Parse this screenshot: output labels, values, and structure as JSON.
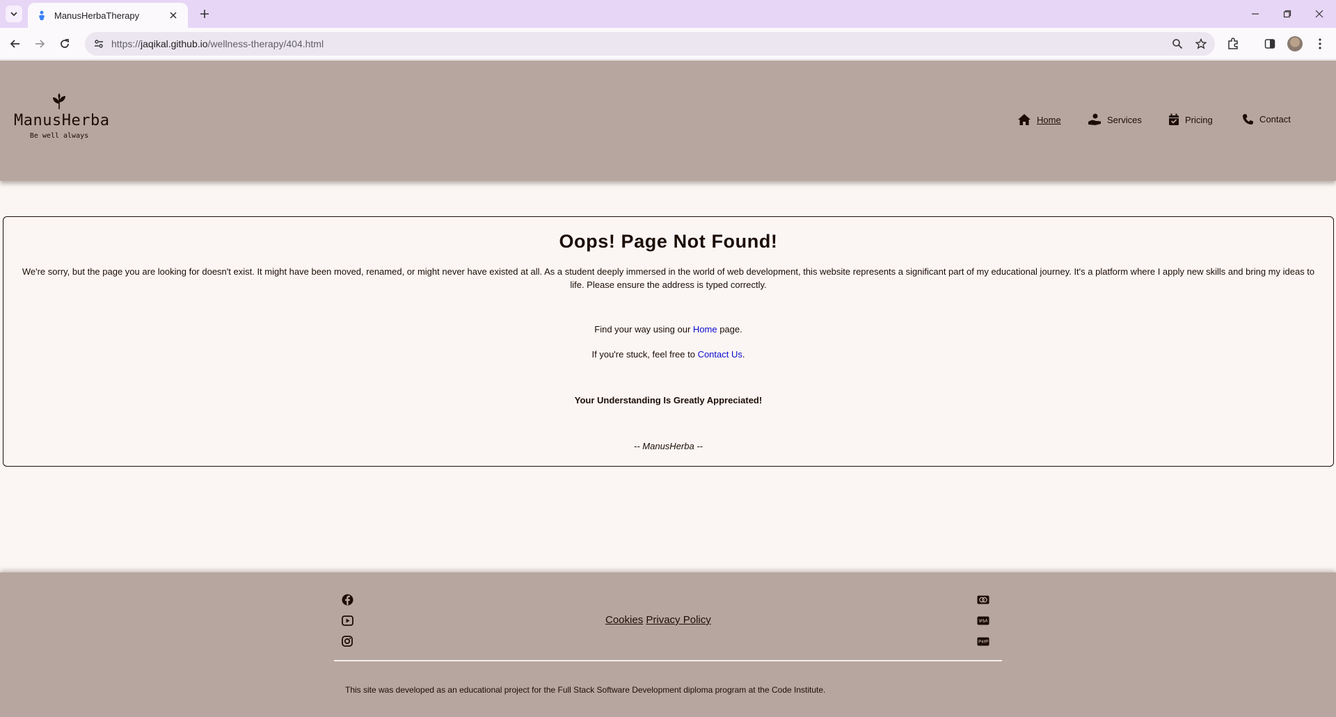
{
  "browser": {
    "tab_title": "ManusHerbaTherapy",
    "url_prefix": "https://",
    "url_host": "jaqikal.github.io",
    "url_path": "/wellness-therapy/404.html"
  },
  "header": {
    "brand_name": "ManusHerba",
    "tagline": "Be well always",
    "nav": [
      {
        "label": "Home",
        "icon": "home-icon"
      },
      {
        "label": "Services",
        "icon": "hand-heart-icon"
      },
      {
        "label": "Pricing",
        "icon": "calendar-check-icon"
      },
      {
        "label": "Contact",
        "icon": "phone-icon"
      }
    ]
  },
  "main": {
    "title": "Oops! Page Not Found!",
    "apology": "We're sorry, but the page you are looking for doesn't exist. It might have been moved, renamed, or might never have existed at all. As a student deeply immersed in the world of web development, this website represents a significant part of my educational journey. It's a platform where I apply new skills and bring my ideas to life. Please ensure the address is typed correctly.",
    "home_prefix": "Find your way using our ",
    "home_link": "Home",
    "home_suffix": " page.",
    "contact_prefix": "If you're stuck, feel free to ",
    "contact_link": "Contact Us",
    "contact_suffix": ".",
    "appreciated": "Your Understanding Is Greatly Appreciated!",
    "signature": "-- ManusHerba --"
  },
  "footer": {
    "social_icons": [
      "facebook-icon",
      "youtube-icon",
      "instagram-icon"
    ],
    "payment_icons": [
      "mastercard-icon",
      "visa-icon",
      "paypal-icon"
    ],
    "cookies_label": "Cookies",
    "privacy_label": "Privacy Policy",
    "note": "This site was developed as an educational project for the Full Stack Software Development diploma program at the Code Institute."
  },
  "colors": {
    "header_bg": "#b7a69f",
    "page_bg": "#fbf6f4",
    "text": "#1b0d06",
    "link": "#0b0bd0"
  }
}
